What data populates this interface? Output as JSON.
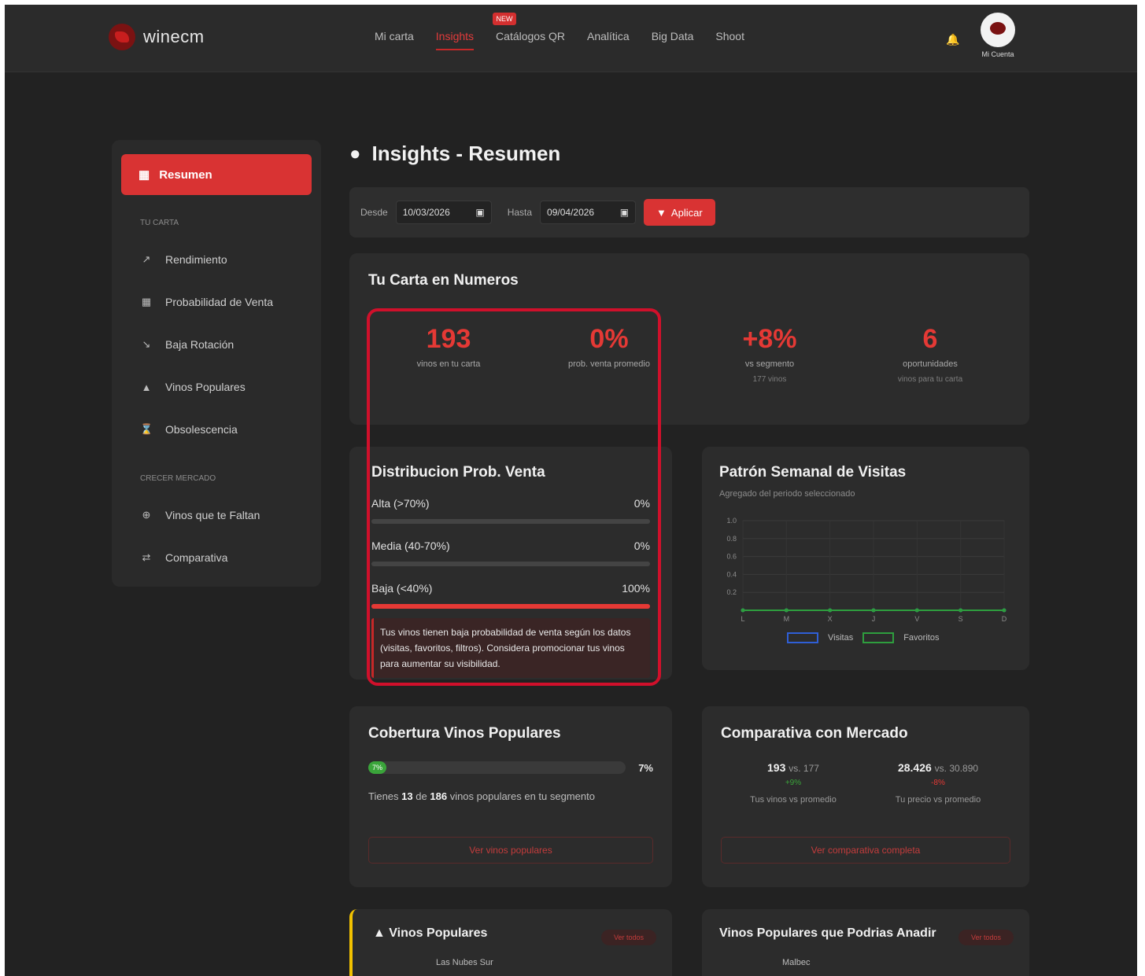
{
  "brand": {
    "name": "winecm"
  },
  "nav": {
    "links": [
      "Mi carta",
      "Insights",
      "Catálogos QR",
      "Analítica",
      "Big Data",
      "Shoot"
    ],
    "badge": "NEW",
    "user_label": "Mi Cuenta"
  },
  "sidebar": {
    "active_label": "Resumen",
    "section1": "TU CARTA",
    "items1": [
      "Rendimiento",
      "Probabilidad de Venta",
      "Baja Rotación",
      "Vinos Populares",
      "Obsolescencia"
    ],
    "section2": "CRECER MERCADO",
    "items2": [
      "Vinos que te Faltan",
      "Comparativa"
    ]
  },
  "page": {
    "title": "Insights - Resumen"
  },
  "filters": {
    "from_label": "Desde",
    "from_value": "10/03/2026",
    "to_label": "Hasta",
    "to_value": "09/04/2026",
    "apply_label": "Aplicar"
  },
  "numbers": {
    "title": "Tu Carta en Numeros",
    "stats": [
      {
        "value": "193",
        "label": "vinos en tu carta",
        "sub": ""
      },
      {
        "value": "0%",
        "label": "prob. venta promedio",
        "sub": ""
      },
      {
        "value": "+8%",
        "label": "vs segmento",
        "sub": "177 vinos"
      },
      {
        "value": "6",
        "label": "oportunidades",
        "sub": "vinos para tu carta"
      }
    ]
  },
  "distribution": {
    "title": "Distribucion Prob. Venta",
    "rows": [
      {
        "label": "Alta (>70%)",
        "value": "0%"
      },
      {
        "label": "Media (40-70%)",
        "value": "0%"
      },
      {
        "label": "Baja (<40%)",
        "value": "100%"
      }
    ],
    "note": "Tus vinos tienen baja probabilidad de venta según los datos (visitas, favoritos, filtros). Considera promocionar tus vinos para aumentar su visibilidad."
  },
  "weekly": {
    "title": "Patrón Semanal de Visitas",
    "subtitle": "Agregado del periodo seleccionado",
    "legend": [
      "Visitas",
      "Favoritos"
    ]
  },
  "chart_data": {
    "type": "line",
    "categories": [
      "L",
      "M",
      "X",
      "J",
      "V",
      "S",
      "D"
    ],
    "series": [
      {
        "name": "Visitas",
        "values": [
          0,
          0,
          0,
          0,
          0,
          0,
          0
        ]
      },
      {
        "name": "Favoritos",
        "values": [
          0,
          0,
          0,
          0,
          0,
          0,
          0
        ]
      }
    ],
    "yticks": [
      "1.0",
      "0.8",
      "0.6",
      "0.4",
      "0.2"
    ],
    "ylim": [
      0,
      1
    ],
    "colors": {
      "Visitas": "#2f5fd6",
      "Favoritos": "#2e9e3e"
    },
    "grid": true,
    "legend_position": "bottom"
  },
  "coverage": {
    "title": "Cobertura Vinos Populares",
    "percent": "7%",
    "percent_value": 0.07,
    "fill_label": "7%",
    "text_prefix": "Tienes",
    "have": "13",
    "text_mid": "de",
    "total": "186",
    "text_suffix": "vinos populares en tu segmento",
    "button": "Ver vinos populares"
  },
  "market": {
    "title": "Comparativa con Mercado",
    "cols": [
      {
        "value": "193",
        "vs": "vs. 177",
        "delta": "+9%",
        "label": "Tus vinos vs promedio"
      },
      {
        "value": "28.426",
        "vs": "vs. 30.890",
        "delta": "-8%",
        "label": "Tu precio vs promedio"
      }
    ],
    "button": "Ver comparativa completa"
  },
  "popular": {
    "title": "Vinos Populares",
    "badge": "Ver todos",
    "first_row": "Las Nubes Sur"
  },
  "popular_missing": {
    "title": "Vinos Populares que Podrias Anadir",
    "badge": "Ver todos",
    "first_row": "Malbec"
  },
  "colors": {
    "accent": "#d93333",
    "background": "#222222",
    "card": "#2c2c2c",
    "success": "#3aa43a",
    "highlight": "#d0102b"
  }
}
